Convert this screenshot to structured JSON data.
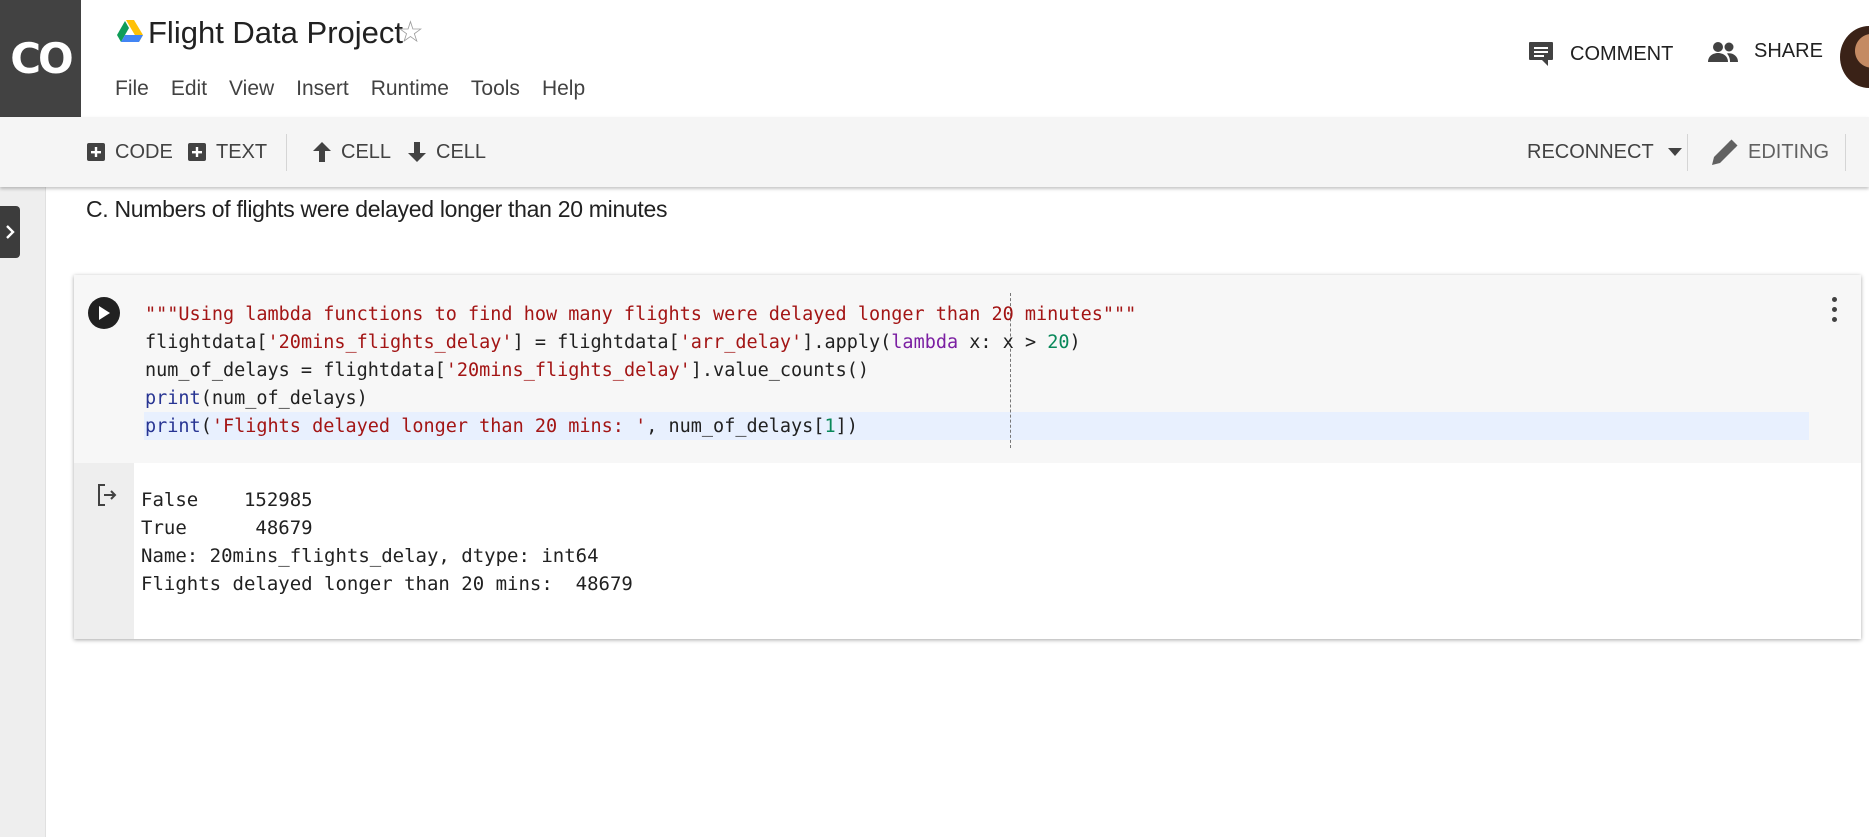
{
  "app": {
    "logo_text": "CO",
    "title": "Flight Data Project",
    "star_icon": "star-outline-icon"
  },
  "menu": [
    "File",
    "Edit",
    "View",
    "Insert",
    "Runtime",
    "Tools",
    "Help"
  ],
  "header_actions": {
    "comment_label": "COMMENT",
    "share_label": "SHARE"
  },
  "toolbar": {
    "add_code_label": "CODE",
    "add_text_label": "TEXT",
    "cell_up_label": "CELL",
    "cell_down_label": "CELL",
    "reconnect_label": "RECONNECT",
    "editing_label": "EDITING"
  },
  "notebook": {
    "text_cell": "C. Numbers of flights were delayed longer than 20 minutes",
    "code_lines": [
      [
        {
          "t": "\"\"\"Using lambda functions to find how many flights were delayed longer than 20 minutes\"\"\"",
          "c": "str"
        }
      ],
      [
        {
          "t": "flightdata[",
          "c": ""
        },
        {
          "t": "'20mins_flights_delay'",
          "c": "str"
        },
        {
          "t": "] = flightdata[",
          "c": ""
        },
        {
          "t": "'arr_delay'",
          "c": "str"
        },
        {
          "t": "].apply(",
          "c": ""
        },
        {
          "t": "lambda",
          "c": "kw"
        },
        {
          "t": " x: x > ",
          "c": ""
        },
        {
          "t": "20",
          "c": "num"
        },
        {
          "t": ")",
          "c": ""
        }
      ],
      [
        {
          "t": "num_of_delays = flightdata[",
          "c": ""
        },
        {
          "t": "'20mins_flights_delay'",
          "c": "str"
        },
        {
          "t": "].value_counts()",
          "c": ""
        }
      ],
      [
        {
          "t": "print",
          "c": "fn"
        },
        {
          "t": "(num_of_delays)",
          "c": ""
        }
      ],
      [
        {
          "t": "print",
          "c": "fn"
        },
        {
          "t": "(",
          "c": ""
        },
        {
          "t": "'Flights delayed longer than 20 mins: '",
          "c": "str"
        },
        {
          "t": ", num_of_delays[",
          "c": ""
        },
        {
          "t": "1",
          "c": "num"
        },
        {
          "t": "])",
          "c": ""
        }
      ]
    ],
    "output_lines": [
      "False    152985",
      "True      48679",
      "Name: 20mins_flights_delay, dtype: int64",
      "Flights delayed longer than 20 mins:  48679"
    ]
  },
  "colors": {
    "string": "#a31515",
    "keyword": "#7b1fa2",
    "number": "#09885a",
    "builtin": "#283593"
  }
}
